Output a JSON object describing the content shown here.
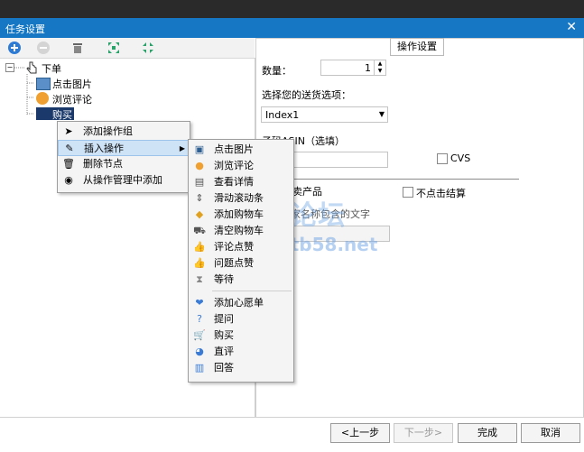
{
  "window": {
    "title": "任务设置"
  },
  "tree": {
    "root_label": "下单",
    "children": [
      "点击图片",
      "浏览评论",
      "购买"
    ]
  },
  "context_menu": {
    "items": [
      "添加操作组",
      "插入操作",
      "删除节点",
      "从操作管理中添加"
    ]
  },
  "submenu": {
    "items": [
      "点击图片",
      "浏览评论",
      "查看详情",
      "滑动滚动条",
      "添加购物车",
      "清空购物车",
      "评论点赞",
      "问题点赞",
      "等待",
      "添加心愿单",
      "提问",
      "购买",
      "直评",
      "回答"
    ]
  },
  "settings": {
    "group_tab": "操作设置",
    "quantity_label": "数量：",
    "quantity_value": "1",
    "shipping_label": "选择您的送货选项：",
    "shipping_value": "Index1",
    "asin_label": "子码ASIN（选填）",
    "asin_placeholder": "",
    "cvs_label": "CVS",
    "follow_seller_label": "跟卖产品",
    "no_checkout_label": "不点击结算",
    "seller_name_label": "家名称包含的文字"
  },
  "footer": {
    "prev": "<上一步",
    "next": "下一步>",
    "finish": "完成",
    "cancel": "取消"
  },
  "watermark": {
    "line1": "TB58论坛",
    "line2": "www.tb58.net"
  }
}
